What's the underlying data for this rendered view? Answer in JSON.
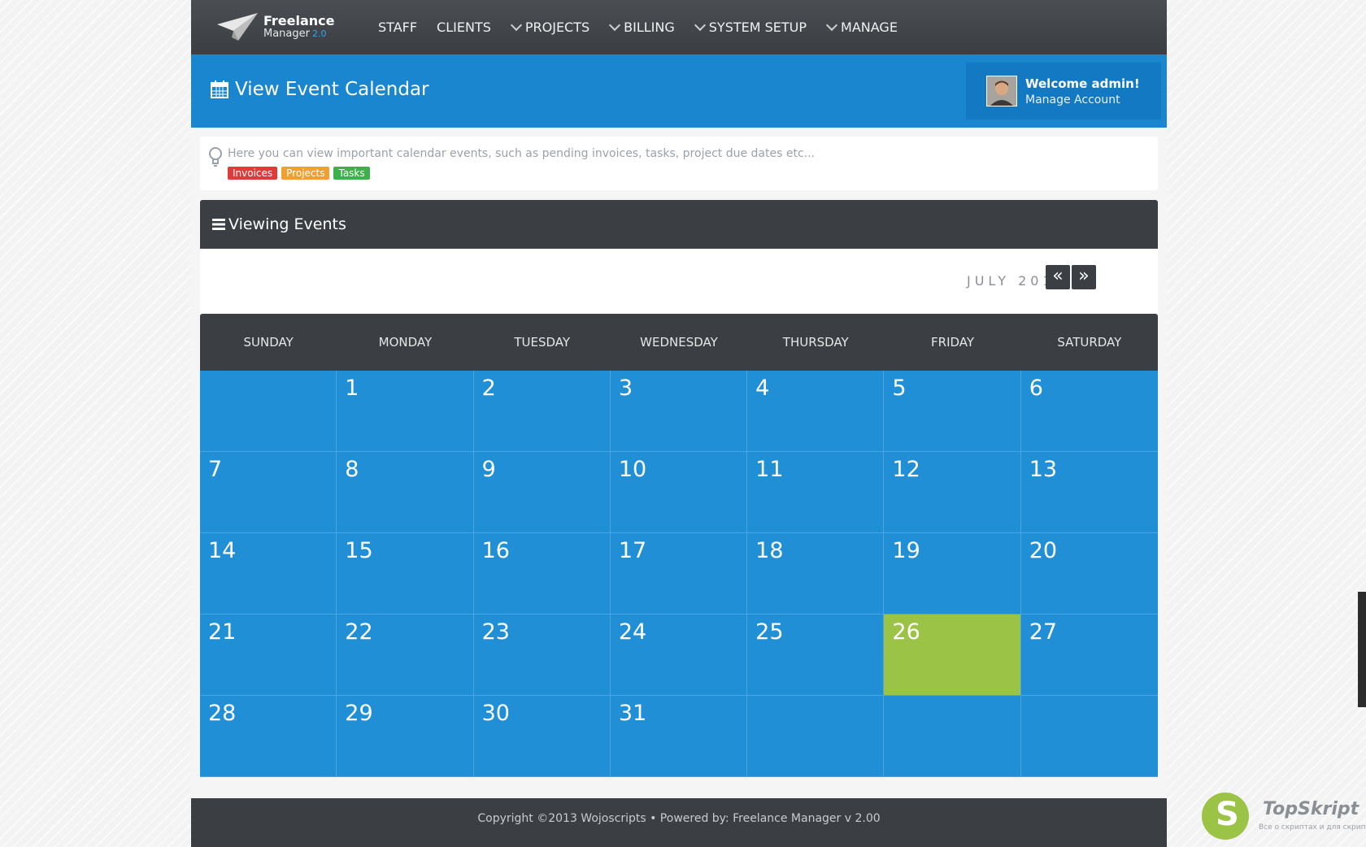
{
  "app": {
    "brand_line1": "Freelance",
    "brand_line2": "Manager",
    "brand_version": "2.0"
  },
  "nav": {
    "items": [
      {
        "label": "STAFF",
        "dropdown": false
      },
      {
        "label": "CLIENTS",
        "dropdown": false
      },
      {
        "label": "PROJECTS",
        "dropdown": true
      },
      {
        "label": "BILLING",
        "dropdown": true
      },
      {
        "label": "SYSTEM SETUP",
        "dropdown": true
      },
      {
        "label": "MANAGE",
        "dropdown": true
      }
    ]
  },
  "header": {
    "title": "View Event Calendar",
    "welcome": "Welcome admin!",
    "manage_account": "Manage Account"
  },
  "info": {
    "message": "Here you can view important calendar events, such as pending invoices, tasks, project due dates etc...",
    "tags": {
      "invoices": "Invoices",
      "projects": "Projects",
      "tasks": "Tasks"
    }
  },
  "panel": {
    "title": "Viewing Events",
    "month_label": "JULY 2013",
    "prev": "«",
    "next": "»"
  },
  "calendar": {
    "weekdays": [
      "SUNDAY",
      "MONDAY",
      "TUESDAY",
      "WEDNESDAY",
      "THURSDAY",
      "FRIDAY",
      "SATURDAY"
    ],
    "cells": [
      "",
      "1",
      "2",
      "3",
      "4",
      "5",
      "6",
      "7",
      "8",
      "9",
      "10",
      "11",
      "12",
      "13",
      "14",
      "15",
      "16",
      "17",
      "18",
      "19",
      "20",
      "21",
      "22",
      "23",
      "24",
      "25",
      "26",
      "27",
      "28",
      "29",
      "30",
      "31",
      "",
      "",
      ""
    ],
    "highlighted_day": "26"
  },
  "footer": {
    "text": "Copyright ©2013 Wojoscripts • Powered by: Freelance Manager v 2.00"
  },
  "watermark": {
    "letter": "S",
    "name": "TopSkript",
    "tagline": "Все о скриптах и для скриптов..."
  },
  "colors": {
    "nav_bg": "#3b3f43",
    "header_bg": "#1a86cf",
    "calendar_cell": "#218fd6",
    "today": "#9bc346"
  }
}
